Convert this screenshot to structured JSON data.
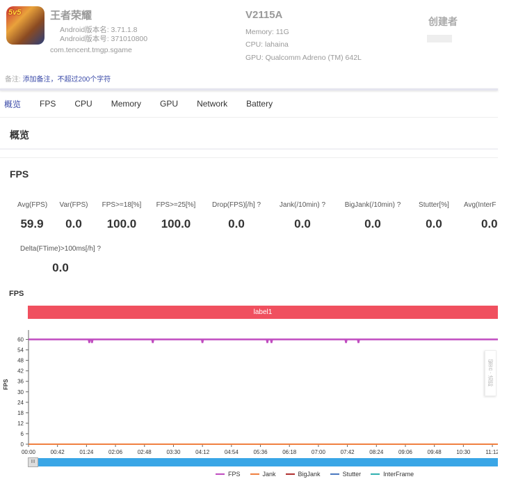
{
  "app": {
    "icon_logo": "5v5",
    "name": "王者荣耀",
    "version_name": "Android版本名: 3.71.1.8",
    "version_code": "Android版本号: 371010800",
    "package": "com.tencent.tmgp.sgame"
  },
  "device": {
    "model": "V2115A",
    "memory": "Memory: 11G",
    "cpu": "CPU: lahaina",
    "gpu": "GPU: Qualcomm Adreno (TM) 642L"
  },
  "creator": {
    "label": "创建者"
  },
  "note": {
    "label": "备注:",
    "link": "添加备注，不超过200个字符"
  },
  "tabs": [
    {
      "label": "概览",
      "active": true
    },
    {
      "label": "FPS"
    },
    {
      "label": "CPU"
    },
    {
      "label": "Memory"
    },
    {
      "label": "GPU"
    },
    {
      "label": "Network"
    },
    {
      "label": "Battery"
    }
  ],
  "overview_title": "概览",
  "fps_section_title": "FPS",
  "metrics": [
    {
      "label": "Avg(FPS)",
      "value": "59.9"
    },
    {
      "label": "Var(FPS)",
      "value": "0.0"
    },
    {
      "label": "FPS>=18[%]",
      "value": "100.0"
    },
    {
      "label": "FPS>=25[%]",
      "value": "100.0"
    },
    {
      "label": "Drop(FPS)[/h] ?",
      "value": "0.0"
    },
    {
      "label": "Jank(/10min) ?",
      "value": "0.0"
    },
    {
      "label": "BigJank(/10min) ?",
      "value": "0.0"
    },
    {
      "label": "Stutter[%]",
      "value": "0.0"
    },
    {
      "label": "Avg(InterF",
      "value": "0.0"
    },
    {
      "label": "Delta(FTime)>100ms[/h] ?",
      "value": "0.0"
    }
  ],
  "side_tab": "留言 · 追踪",
  "chart_data": {
    "type": "line",
    "title": "FPS",
    "label_band": "label1",
    "ylabel": "FPS",
    "ylim": [
      0,
      63
    ],
    "yticks": [
      "0",
      "6",
      "12",
      "18",
      "24",
      "30",
      "36",
      "42",
      "48",
      "54",
      "60"
    ],
    "xticks": [
      "00:00",
      "00:42",
      "01:24",
      "02:06",
      "02:48",
      "03:30",
      "04:12",
      "04:54",
      "05:36",
      "06:18",
      "07:00",
      "07:42",
      "08:24",
      "09:06",
      "09:48",
      "10:30",
      "11:12"
    ],
    "xlim": [
      "00:00",
      "11:20"
    ],
    "grid": false,
    "legend_position": "bottom",
    "colors": {
      "FPS": "#c04cc0",
      "Jank": "#f08040",
      "BigJank": "#b03030",
      "Stutter": "#4a78c0",
      "InterFrame": "#30b0b0",
      "band": "#f0505f",
      "slider": "#3aa6e6"
    },
    "series": [
      {
        "name": "FPS",
        "points": [
          [
            "00:00",
            60
          ],
          [
            "01:27",
            60
          ],
          [
            "01:28",
            58
          ],
          [
            "01:29",
            60
          ],
          [
            "01:31",
            60
          ],
          [
            "01:32",
            58
          ],
          [
            "01:33",
            60
          ],
          [
            "02:59",
            60
          ],
          [
            "03:00",
            58
          ],
          [
            "03:01",
            60
          ],
          [
            "04:11",
            60
          ],
          [
            "04:12",
            58
          ],
          [
            "04:13",
            60
          ],
          [
            "05:45",
            60
          ],
          [
            "05:46",
            58
          ],
          [
            "05:47",
            60
          ],
          [
            "05:51",
            60
          ],
          [
            "05:52",
            58
          ],
          [
            "05:53",
            60
          ],
          [
            "07:39",
            60
          ],
          [
            "07:40",
            58
          ],
          [
            "07:41",
            60
          ],
          [
            "07:57",
            60
          ],
          [
            "07:58",
            58
          ],
          [
            "07:59",
            60
          ],
          [
            "11:20",
            60
          ]
        ]
      },
      {
        "name": "Jank",
        "points": [
          [
            "00:00",
            0
          ],
          [
            "11:20",
            0
          ]
        ]
      },
      {
        "name": "BigJank",
        "points": [
          [
            "00:00",
            0
          ],
          [
            "11:20",
            0
          ]
        ]
      },
      {
        "name": "Stutter",
        "points": [
          [
            "00:00",
            0
          ],
          [
            "11:20",
            0
          ]
        ]
      },
      {
        "name": "InterFrame",
        "points": [
          [
            "00:00",
            0
          ],
          [
            "11:20",
            0
          ]
        ]
      }
    ]
  }
}
